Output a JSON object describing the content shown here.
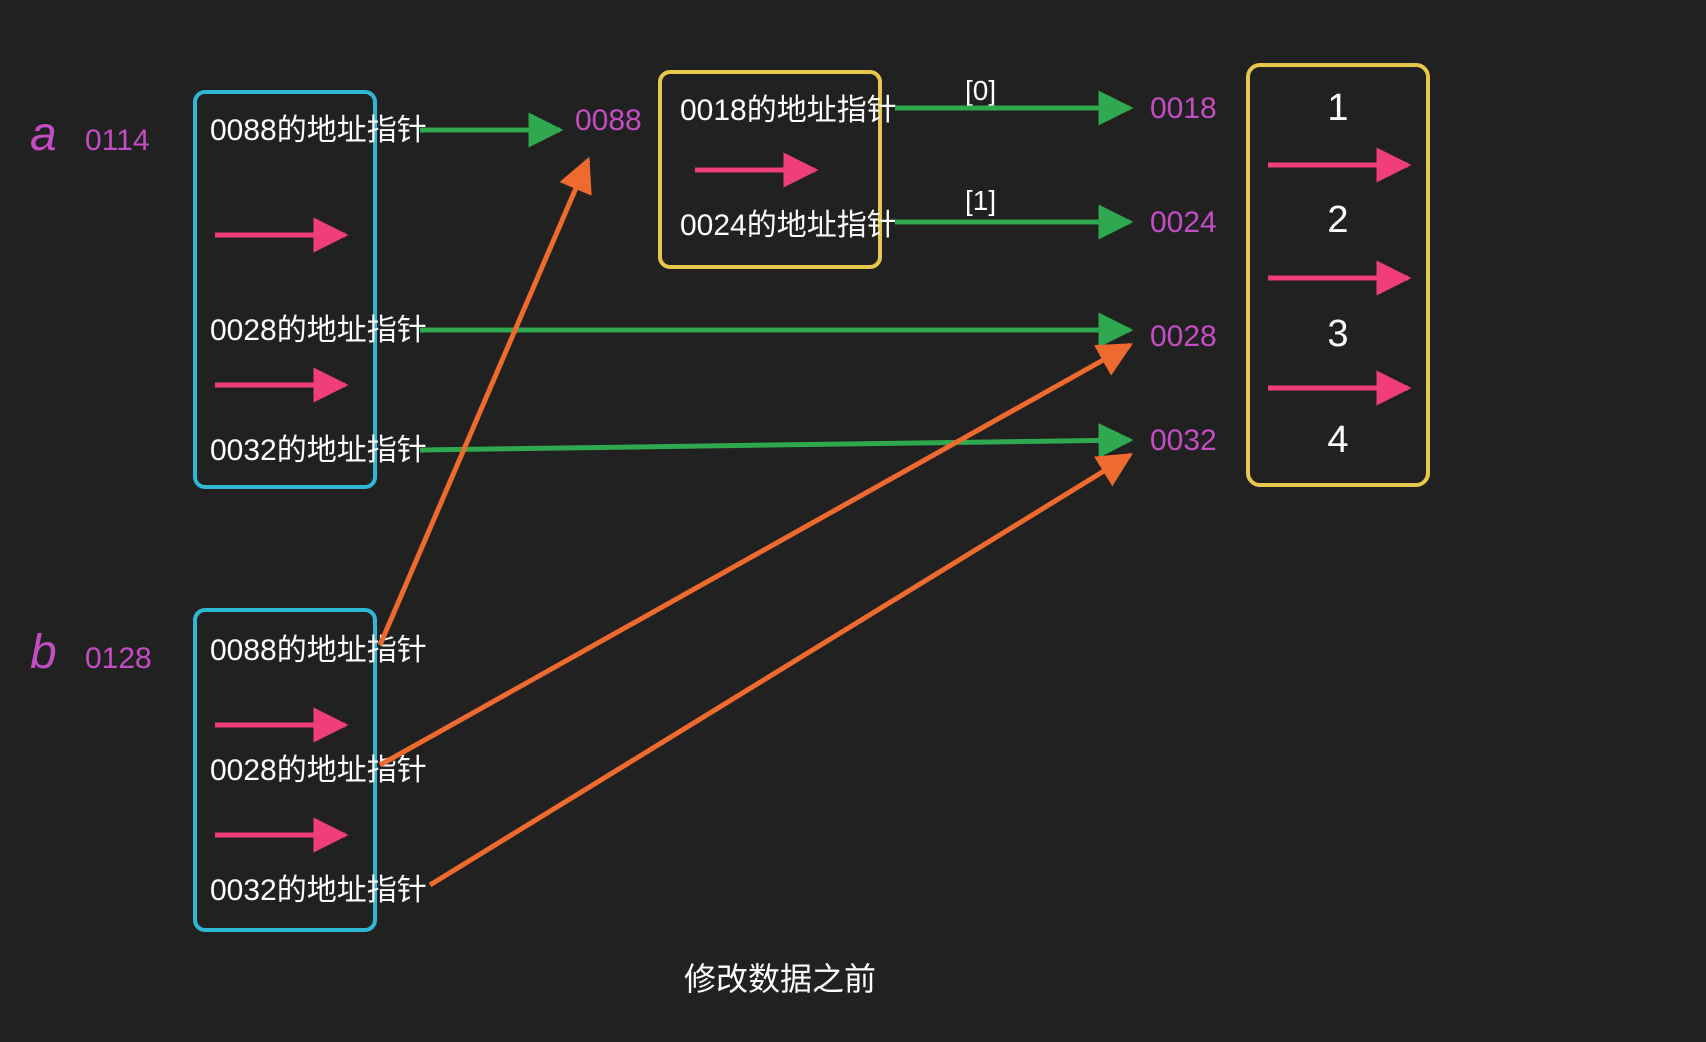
{
  "caption": "修改数据之前",
  "vars": {
    "a": {
      "name": "a",
      "addr": "0114"
    },
    "b": {
      "name": "b",
      "addr": "0128"
    }
  },
  "boxA": {
    "items": [
      "0088的地址指针",
      "0028的地址指针",
      "0032的地址指针"
    ]
  },
  "boxB": {
    "items": [
      "0088的地址指针",
      "0028的地址指针",
      "0032的地址指针"
    ]
  },
  "addr0088": "0088",
  "innerBox": {
    "items": [
      "0018的地址指针",
      "0024的地址指针"
    ]
  },
  "indices": [
    "[0]",
    "[1]"
  ],
  "addrs": {
    "a0": "0018",
    "a1": "0024",
    "a2": "0028",
    "a3": "0032"
  },
  "values": [
    "1",
    "2",
    "3",
    "4"
  ],
  "colors": {
    "bg": "#212121",
    "cyan": "#2eb8d4",
    "yellow": "#e8c84a",
    "green": "#2fa84f",
    "pink": "#ef3e7a",
    "orange": "#ef6a2f",
    "purple": "#c44dc4",
    "white": "#ffffff"
  }
}
